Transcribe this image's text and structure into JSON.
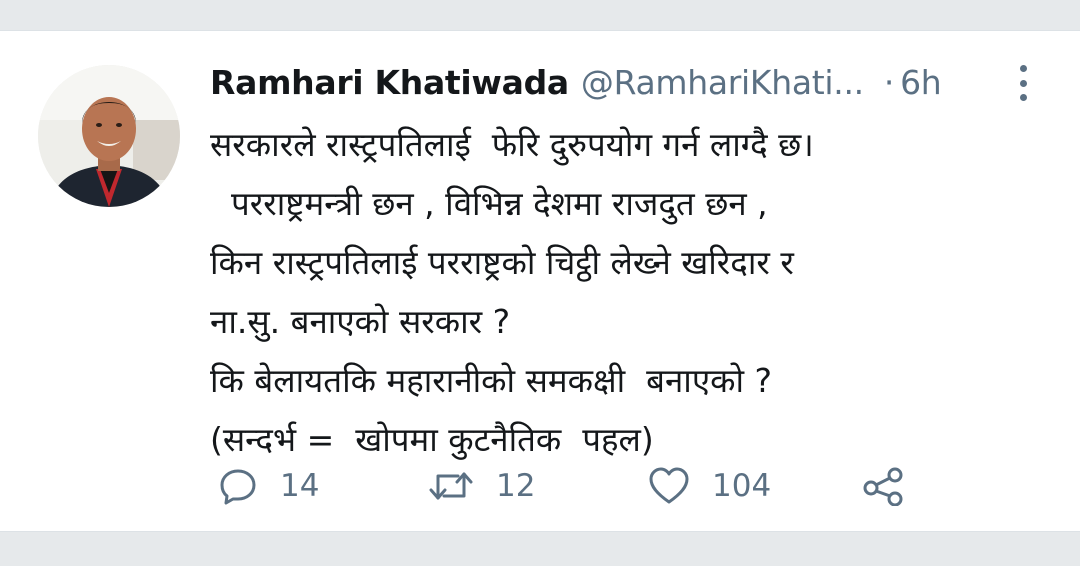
{
  "tweet": {
    "author_name": "Ramhari Khatiwada",
    "handle": "@RamhariKhati...",
    "separator": "·",
    "time": "6h",
    "text_lines": [
      "सरकारले रास्ट्रपतिलाई  फेरि दुरुपयोग गर्न लाग्दै छ।",
      "  परराष्ट्रमन्त्री छन , विभिन्न देशमा राजदुत छन ,",
      "किन रास्ट्रपतिलाई परराष्ट्रको चिट्ठी लेख्ने खरिदार र",
      "ना.सु. बनाएको सरकार ?",
      "कि बेलायतकि महारानीको समकक्षी  बनाएको ?",
      "(सन्दर्भ =  खोपमा कुटनैतिक  पहल)"
    ],
    "actions": {
      "reply_count": "14",
      "retweet_count": "12",
      "like_count": "104"
    },
    "icons": {
      "reply": "reply-icon",
      "retweet": "retweet-icon",
      "like": "heart-icon",
      "share": "share-icon",
      "more": "more-options-icon"
    }
  },
  "colors": {
    "text_primary": "#14171a",
    "text_secondary": "#5b7083",
    "background": "#ffffff",
    "page_background": "#e6e9eb"
  }
}
